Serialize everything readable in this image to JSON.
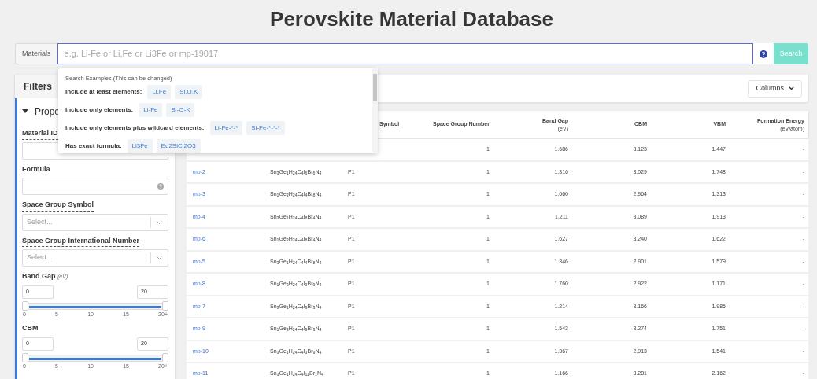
{
  "title": "Perovskite Material Database",
  "search": {
    "label": "Materials",
    "placeholder": "e.g. Li-Fe or Li,Fe or Li3Fe or mp-19017",
    "button": "Search"
  },
  "suggestions": {
    "heading": "Search Examples (This can be changed)",
    "groups": [
      {
        "label": "Include at least elements:",
        "chips": [
          "Li,Fe",
          "Si,O,K"
        ]
      },
      {
        "label": "Include only elements:",
        "chips": [
          "Li-Fe",
          "Si-O-K"
        ]
      },
      {
        "label": "Include only elements plus wildcard elements:",
        "chips": [
          "Li-Fe-*-*",
          "Si-Fe-*-*-*"
        ]
      },
      {
        "label": "Has exact formula:",
        "chips": [
          "Li3Fe",
          "Eu2SiCl2O3"
        ]
      }
    ]
  },
  "filters": {
    "title": "Filters",
    "section": {
      "title": "Prope",
      "expanded": true,
      "fields": [
        {
          "kind": "text",
          "label": "Material ID",
          "hint": true
        },
        {
          "kind": "text",
          "label": "Formula",
          "hint": true,
          "help": true
        },
        {
          "kind": "select",
          "label": "Space Group Symbol",
          "hint": true,
          "placeholder": "Select..."
        },
        {
          "kind": "select",
          "label": "Space Group International Number",
          "hint": true,
          "placeholder": "Select..."
        },
        {
          "kind": "range",
          "label": "Band Gap",
          "unit": "(eV)",
          "min_value": "0",
          "max_value": "20",
          "level": 1,
          "ticks": [
            "0",
            "5",
            "10",
            "15",
            "20+"
          ]
        },
        {
          "kind": "range",
          "label": "CBM",
          "min_value": "0",
          "max_value": "20",
          "level": 1,
          "ticks": [
            "0",
            "5",
            "10",
            "15",
            "20+"
          ]
        }
      ]
    }
  },
  "columns_button": "Columns",
  "table": {
    "columns": [
      {
        "label": "Symbol",
        "hint": true
      },
      {
        "label": "Space Group Number"
      },
      {
        "label": "Band Gap",
        "unit": "(eV)"
      },
      {
        "label": "CBM"
      },
      {
        "label": "VBM"
      },
      {
        "label": "Formation Energy",
        "unit": "(eV/atom)"
      }
    ],
    "rows": [
      {
        "space_group_number": "1",
        "band_gap": "1.686",
        "cbm": "3.123",
        "vbm": "1.447",
        "formation_energy": "-"
      },
      {
        "id": "mp-2",
        "formula": "Sn$_{3}$Ge$_{1}$H$_{24}$C$_{4}$I$_{6}$Br$_{6}$N$_{4}$",
        "symbol": "P1",
        "space_group_number": "1",
        "band_gap": "1.316",
        "cbm": "3.029",
        "vbm": "1.748",
        "formation_energy": "-"
      },
      {
        "id": "mp-3",
        "formula": "Sn$_{1}$Ge$_{3}$H$_{24}$C$_{4}$I$_{4}$Br$_{8}$N$_{4}$",
        "symbol": "P1",
        "space_group_number": "1",
        "band_gap": "1.660",
        "cbm": "2.964",
        "vbm": "1.313",
        "formation_energy": "-"
      },
      {
        "id": "mp-4",
        "formula": "Sn$_{3}$Ge$_{1}$H$_{24}$C$_{4}$I$_{8}$Br$_{4}$N$_{4}$",
        "symbol": "P1",
        "space_group_number": "1",
        "band_gap": "1.211",
        "cbm": "3.089",
        "vbm": "1.913",
        "formation_energy": "-"
      },
      {
        "id": "mp-6",
        "formula": "Sn$_{1}$Ge$_{3}$H$_{24}$C$_{4}$I$_{8}$Br$_{4}$N$_{4}$",
        "symbol": "P1",
        "space_group_number": "1",
        "band_gap": "1.627",
        "cbm": "3.240",
        "vbm": "1.622",
        "formation_energy": "-"
      },
      {
        "id": "mp-5",
        "formula": "Sn$_{3}$Ge$_{1}$H$_{24}$C$_{4}$I$_{4}$Br$_{8}$N$_{4}$",
        "symbol": "P1",
        "space_group_number": "1",
        "band_gap": "1.346",
        "cbm": "2.901",
        "vbm": "1.579",
        "formation_energy": "-"
      },
      {
        "id": "mp-8",
        "formula": "Sn$_{1}$Ge$_{3}$H$_{24}$C$_{4}$I$_{3}$Br$_{9}$N$_{4}$",
        "symbol": "P1",
        "space_group_number": "1",
        "band_gap": "1.760",
        "cbm": "2.922",
        "vbm": "1.171",
        "formation_energy": "-"
      },
      {
        "id": "mp-7",
        "formula": "Sn$_{3}$Ge$_{1}$H$_{24}$C$_{4}$I$_{9}$Br$_{3}$N$_{4}$",
        "symbol": "P1",
        "space_group_number": "1",
        "band_gap": "1.214",
        "cbm": "3.166",
        "vbm": "1.985",
        "formation_energy": "-"
      },
      {
        "id": "mp-9",
        "formula": "Sn$_{1}$Ge$_{3}$H$_{24}$C$_{4}$I$_{9}$Br$_{3}$N$_{4}$",
        "symbol": "P1",
        "space_group_number": "1",
        "band_gap": "1.543",
        "cbm": "3.274",
        "vbm": "1.751",
        "formation_energy": "-"
      },
      {
        "id": "mp-10",
        "formula": "Sn$_{3}$Ge$_{1}$H$_{24}$C$_{4}$I$_{3}$Br$_{9}$N$_{4}$",
        "symbol": "P1",
        "space_group_number": "1",
        "band_gap": "1.367",
        "cbm": "2.913",
        "vbm": "1.541",
        "formation_energy": "-"
      },
      {
        "id": "mp-11",
        "formula": "Sn$_{3}$Ge$_{1}$H$_{24}$C$_{4}$I$_{11}$Br$_{1}$N$_{4}$",
        "symbol": "P1",
        "space_group_number": "1",
        "band_gap": "1.166",
        "cbm": "3.281",
        "vbm": "2.162",
        "formation_energy": "-"
      }
    ]
  }
}
